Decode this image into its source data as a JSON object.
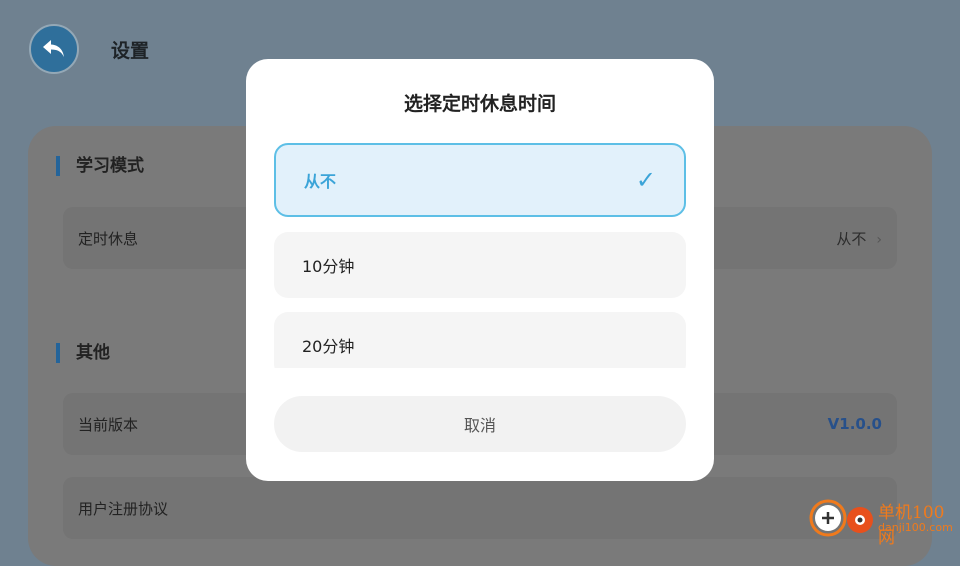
{
  "header": {
    "title": "设置"
  },
  "sections": [
    {
      "title": "学习模式",
      "rows": [
        {
          "label": "定时休息",
          "value": "从不"
        }
      ]
    },
    {
      "title": "其他",
      "rows": [
        {
          "label": "当前版本",
          "value": "V1.0.0"
        },
        {
          "label": "用户注册协议",
          "value": ""
        }
      ]
    }
  ],
  "modal": {
    "title": "选择定时休息时间",
    "options": [
      {
        "label": "从不",
        "selected": true
      },
      {
        "label": "10分钟",
        "selected": false
      },
      {
        "label": "20分钟",
        "selected": false
      }
    ],
    "cancel_label": "取消"
  },
  "watermark": {
    "name": "单机100网",
    "site": "danji100.com"
  },
  "colors": {
    "accent": "#3ba4d8",
    "overlay": "#6f8190",
    "version_blue": "#27508a"
  }
}
